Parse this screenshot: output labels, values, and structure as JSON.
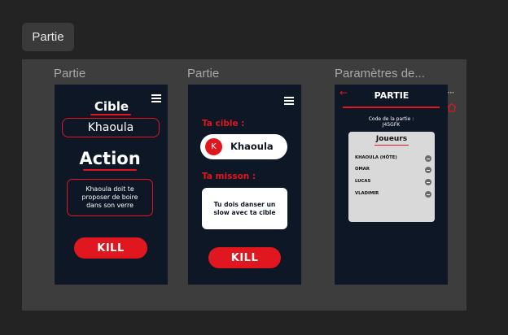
{
  "section_chip": "Partie",
  "frames": [
    {
      "label": "Partie",
      "cible_heading": "Cible",
      "target_name": "Khaoula",
      "action_heading": "Action",
      "action_text": "Khaoula doit te proposer de boire dans son verre",
      "kill_label": "KILL"
    },
    {
      "label": "Partie",
      "target_heading": "Ta cible :",
      "avatar_letter": "K",
      "target_name": "Khaoula",
      "mission_heading": "Ta misson :",
      "mission_text": "Tu dois danser un slow avec ta cible",
      "kill_label": "KILL"
    },
    {
      "label": "Paramètres de...",
      "title": "PARTIE",
      "code_label": "Code de la partie :",
      "code_value": "J45GFK",
      "players_heading": "Joueurs",
      "players": [
        "KHAOULA (HÔTE)",
        "OMAR",
        "LUCAS",
        "VLADIMIR"
      ]
    }
  ],
  "colors": {
    "canvas": "#232323",
    "section": "#3d3d3d",
    "phone_bg": "#0d1725",
    "accent_red": "#e0171f",
    "panel_gray": "#d9d9d9"
  },
  "icons": [
    "menu-icon",
    "back-arrow-icon",
    "home-icon",
    "more-options-icon",
    "remove-player-icon"
  ]
}
